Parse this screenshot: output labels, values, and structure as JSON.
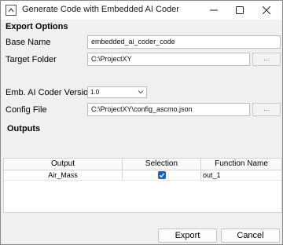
{
  "window": {
    "title": "Generate Code with Embedded AI Coder"
  },
  "export_options": {
    "heading": "Export Options",
    "base_name": {
      "label": "Base Name",
      "value": "embedded_ai_coder_code"
    },
    "target_folder": {
      "label": "Target Folder",
      "value": "C:\\ProjectXY",
      "browse_label": "..."
    },
    "coder_version": {
      "label": "Emb. AI Coder Version",
      "value": "1.0"
    },
    "config_file": {
      "label": "Config File",
      "value": "C:\\ProjectXY\\config_ascmo.json",
      "browse_label": "..."
    }
  },
  "outputs": {
    "heading": "Outputs",
    "columns": [
      "Output",
      "Selection",
      "Function Name"
    ],
    "rows": [
      {
        "output": "Air_Mass",
        "selected": true,
        "function_name": "out_1"
      }
    ]
  },
  "buttons": {
    "export": "Export",
    "cancel": "Cancel"
  },
  "colors": {
    "accent": "#1e63b8",
    "window_bg": "#f0f0f0"
  }
}
